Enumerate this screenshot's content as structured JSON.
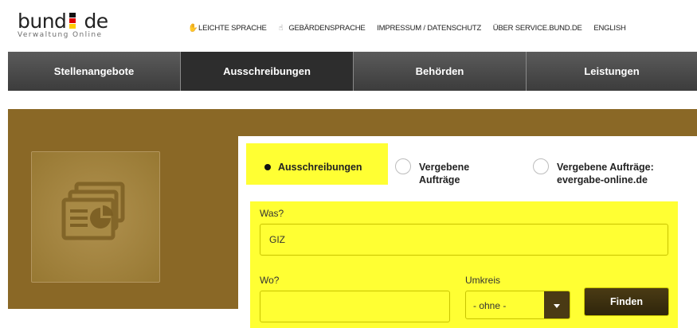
{
  "logo": {
    "main_left": "bund",
    "main_right": "de",
    "sub": "Verwaltung Online",
    "flag_colors": [
      "#111111",
      "#dd0000",
      "#ffcc00"
    ]
  },
  "topnav": [
    {
      "icon": "hand-icon",
      "label": "LEICHTE SPRACHE"
    },
    {
      "icon": "sign-language-icon",
      "label": "GEBÄRDENSPRACHE"
    },
    {
      "icon": "",
      "label": "IMPRESSUM / DATENSCHUTZ"
    },
    {
      "icon": "",
      "label": "ÜBER SERVICE.BUND.DE"
    },
    {
      "icon": "",
      "label": "ENGLISH"
    }
  ],
  "mainnav": [
    "Stellenangebote",
    "Ausschreibungen",
    "Behörden",
    "Leistungen"
  ],
  "mainnav_active": "Ausschreibungen",
  "search": {
    "radios": [
      {
        "label": "Ausschreibungen",
        "checked": true
      },
      {
        "label": "Vergebene Aufträge",
        "checked": false
      },
      {
        "label": "Vergebene Aufträge: evergabe-online.de",
        "checked": false
      }
    ],
    "radio_lines": {
      "r2_line1": "Vergebene",
      "r2_line2": "Aufträge",
      "r3_line1": "Vergebene Aufträge:",
      "r3_line2": "evergabe-online.de"
    },
    "was_label": "Was?",
    "was_value": "GIZ",
    "wo_label": "Wo?",
    "wo_value": "",
    "umkreis_label": "Umkreis",
    "umkreis_value": "- ohne -",
    "find_button": "Finden"
  },
  "colors": {
    "highlight": "#ffff33",
    "hero": "#8a6826",
    "nav": "#3c3c3c"
  }
}
